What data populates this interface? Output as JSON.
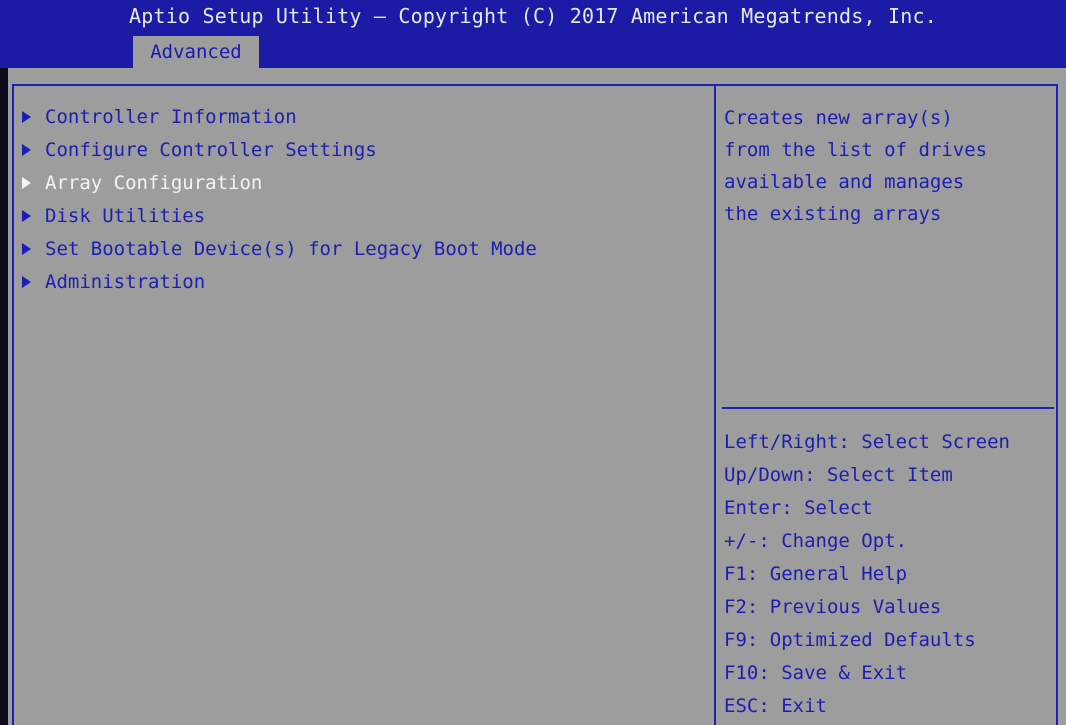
{
  "header": {
    "title": "Aptio Setup Utility – Copyright (C) 2017 American Megatrends, Inc.",
    "active_tab": "Advanced"
  },
  "menu": {
    "items": [
      {
        "label": "Controller Information"
      },
      {
        "label": "Configure Controller Settings"
      },
      {
        "label": "Array Configuration"
      },
      {
        "label": "Disk Utilities"
      },
      {
        "label": "Set Bootable Device(s) for Legacy Boot Mode"
      },
      {
        "label": "Administration"
      }
    ],
    "selected_index": 2
  },
  "help": {
    "lines": [
      "Creates new array(s)",
      "from the list of drives",
      "available and manages",
      "the existing arrays"
    ]
  },
  "keys": {
    "lines": [
      "Left/Right: Select Screen",
      "Up/Down: Select Item",
      "Enter: Select",
      "+/-: Change Opt.",
      "F1: General Help",
      "F2: Previous Values",
      "F9: Optimized Defaults",
      "F10: Save & Exit",
      "ESC: Exit"
    ]
  },
  "colors": {
    "header_bg": "#1b1ba6",
    "panel_bg": "#9d9d9d",
    "text_blue": "#1d1db2",
    "selected_text": "#f4f4f4"
  }
}
